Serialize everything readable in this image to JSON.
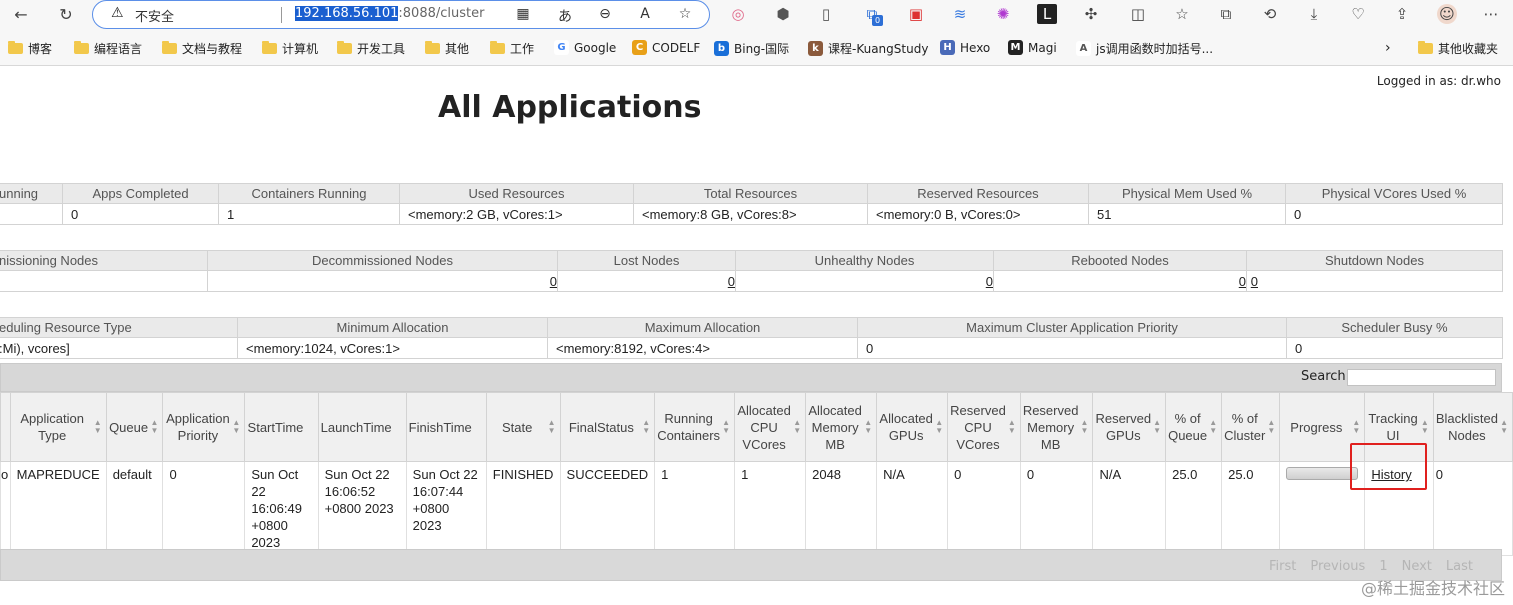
{
  "browser": {
    "address_insecure": "不安全",
    "url_host": "192.168.56.101",
    "url_rest": ":8088/cluster",
    "bookmarks": [
      "博客",
      "编程语言",
      "文档与教程",
      "计算机",
      "开发工具",
      "其他",
      "工作",
      "Google",
      "CODELF",
      "Bing-国际",
      "课程-KuangStudy",
      "Hexo",
      "Magi",
      "js调用函数时加括号...",
      "其他收藏夹"
    ],
    "badge": "0"
  },
  "page": {
    "logged_in": "Logged in as: dr.who",
    "title": "All Applications"
  },
  "cluster_metrics": {
    "headers": [
      "unning",
      "Apps Completed",
      "Containers Running",
      "Used Resources",
      "Total Resources",
      "Reserved Resources",
      "Physical Mem Used %",
      "Physical VCores Used %"
    ],
    "values": [
      "",
      "0",
      "1",
      "<memory:2 GB, vCores:1>",
      "<memory:8 GB, vCores:8>",
      "<memory:0 B, vCores:0>",
      "51",
      "0"
    ]
  },
  "node_metrics": {
    "headers": [
      "nissioning Nodes",
      "Decommissioned Nodes",
      "Lost Nodes",
      "Unhealthy Nodes",
      "Rebooted Nodes",
      "Shutdown Nodes"
    ],
    "values": [
      "",
      "0",
      "0",
      "0",
      "0",
      "0"
    ]
  },
  "scheduler_metrics": {
    "headers": [
      "eduling Resource Type",
      "Minimum Allocation",
      "Maximum Allocation",
      "Maximum Cluster Application Priority",
      "Scheduler Busy %"
    ],
    "values": [
      ":Mi), vcores]",
      "<memory:1024, vCores:1>",
      "<memory:8192, vCores:4>",
      "0",
      "0"
    ]
  },
  "apps_table": {
    "search_label": "Search:",
    "headers": [
      "",
      "Application Type",
      "Queue",
      "Application Priority",
      "StartTime",
      "LaunchTime",
      "FinishTime",
      "State",
      "FinalStatus",
      "Running Containers",
      "Allocated CPU VCores",
      "Allocated Memory MB",
      "Allocated GPUs",
      "Reserved CPU VCores",
      "Reserved Memory MB",
      "Reserved GPUs",
      "% of Queue",
      "% of Cluster",
      "Progress",
      "Tracking UI",
      "Blacklisted Nodes"
    ],
    "row": {
      "name": "o",
      "type": "MAPREDUCE",
      "queue": "default",
      "priority": "0",
      "start": "Sun Oct 22 16:06:49 +0800 2023",
      "launch": "Sun Oct 22 16:06:52 +0800 2023",
      "finish": "Sun Oct 22 16:07:44 +0800 2023",
      "state": "FINISHED",
      "final_status": "SUCCEEDED",
      "running_containers": "1",
      "alloc_vcores": "1",
      "alloc_mem": "2048",
      "alloc_gpus": "N/A",
      "res_vcores": "0",
      "res_mem": "0",
      "res_gpus": "N/A",
      "pct_queue": "25.0",
      "pct_cluster": "25.0",
      "progress": 1.0,
      "tracking": "History",
      "blacklisted": "0"
    },
    "pager": [
      "First",
      "Previous",
      "1",
      "Next",
      "Last"
    ]
  },
  "watermark": "@稀土掘金技术社区"
}
